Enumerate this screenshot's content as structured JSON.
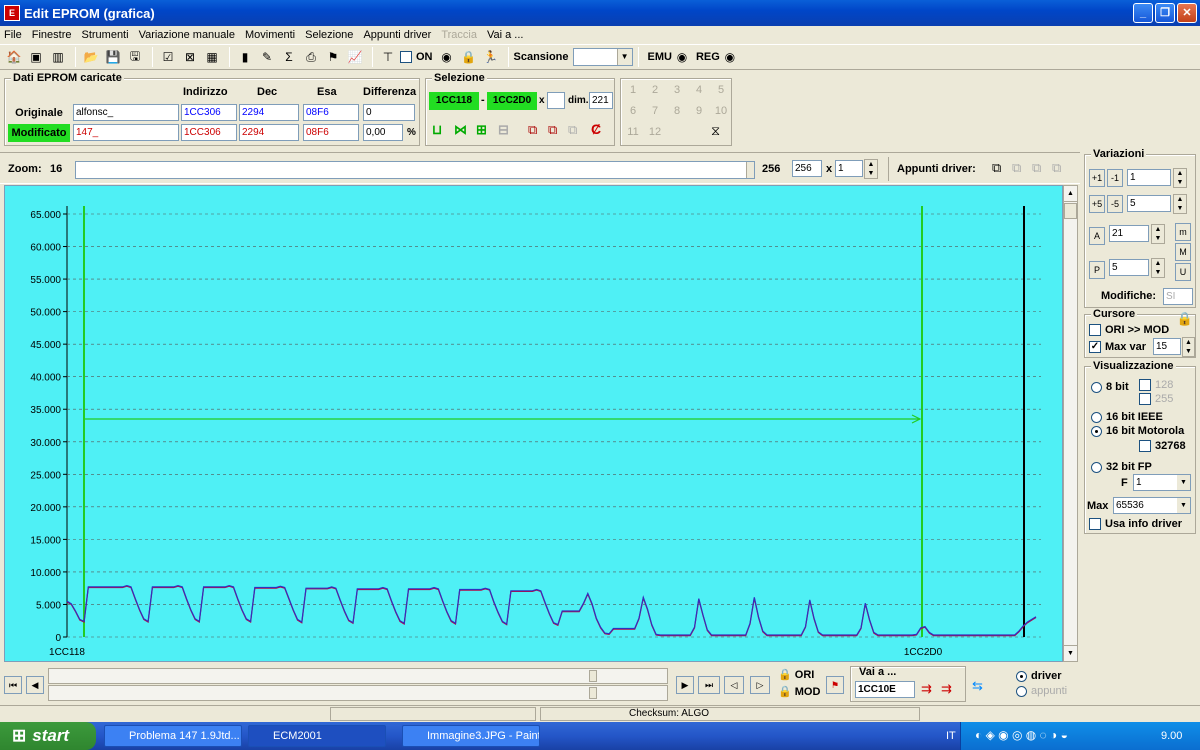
{
  "window": {
    "title": "Edit EPROM (grafica)",
    "minimize": "_",
    "maximize": "❐",
    "close": "✕"
  },
  "menu": [
    "File",
    "Finestre",
    "Strumenti",
    "Variazione manuale",
    "Movimenti",
    "Selezione",
    "Appunti driver",
    "Traccia",
    "Vai a ..."
  ],
  "toolbar": {
    "on_label": "ON",
    "scansione_label": "Scansione",
    "emu_label": "EMU",
    "reg_label": "REG"
  },
  "dati": {
    "title": "Dati EPROM caricate",
    "headers": {
      "indirizzo": "Indirizzo",
      "dec": "Dec",
      "esa": "Esa",
      "differenza": "Differenza"
    },
    "originale": {
      "label": "Originale",
      "name": "alfonsc_",
      "indirizzo": "1CC306",
      "dec": "2294",
      "esa": "08F6",
      "differenza": "0"
    },
    "modificato": {
      "label": "Modificato",
      "name": "147_",
      "indirizzo": "1CC306",
      "dec": "2294",
      "esa": "08F6",
      "differenza": "0,00",
      "unit": "%"
    }
  },
  "selezione": {
    "title": "Selezione",
    "start": "1CC118",
    "dash": "-",
    "end": "1CC2D0",
    "x_label": "x",
    "dim_label": "dim.",
    "dim_value": "221"
  },
  "numpad": [
    "1",
    "2",
    "3",
    "4",
    "5",
    "6",
    "7",
    "8",
    "9",
    "10",
    "11",
    "12"
  ],
  "zoom": {
    "label": "Zoom:",
    "min": "16",
    "max": "256",
    "value": "256",
    "x_label": "x",
    "mult": "1"
  },
  "appunti": {
    "label": "Appunti driver:"
  },
  "chart_data": {
    "type": "line",
    "y_ticks": [
      "65.000",
      "60.000",
      "55.000",
      "50.000",
      "45.000",
      "40.000",
      "35.000",
      "30.000",
      "25.000",
      "20.000",
      "15.000",
      "10.000",
      "5.000",
      "0"
    ],
    "ylim": [
      0,
      65000
    ],
    "x_start_label": "1CC118",
    "x_end_label": "1CC2D0",
    "grid": "dashed horizontal",
    "series": [
      {
        "color": "#d0002a",
        "values": [
          5400,
          5000,
          3900,
          2600,
          2300,
          7600,
          7600,
          7600,
          7600,
          7600,
          7600,
          7600,
          7600,
          7600,
          7800,
          7600,
          5800,
          4100,
          2700,
          2300,
          7600,
          7600,
          7600,
          7600,
          7600,
          7600,
          7800,
          7600,
          5800,
          4100,
          2700,
          2300,
          7600,
          7600,
          7600,
          7600,
          7600,
          7600,
          7800,
          7600,
          5800,
          4100,
          2700,
          2300,
          7500,
          7500,
          7500,
          7500,
          7500,
          7500,
          7700,
          7500,
          5800,
          4100,
          2600,
          2200,
          7400,
          7400,
          7400,
          7400,
          7400,
          7400,
          7600,
          7400,
          5600,
          3900,
          2500,
          2100,
          7300,
          7300,
          7300,
          7300,
          7300,
          7300,
          7500,
          7300,
          5500,
          3800,
          2400,
          2000,
          7300,
          7300,
          7300,
          7300,
          7300,
          7300,
          7500,
          7300,
          5500,
          3800,
          2400,
          2000,
          7200,
          7200,
          7200,
          7200,
          7200,
          7200,
          7400,
          7200,
          5300,
          3700,
          2300,
          1900,
          7000,
          7000,
          7000,
          7000,
          7000,
          7000,
          7200,
          7000,
          5200,
          3500,
          2100,
          1800,
          3900,
          3900,
          3900,
          3900,
          3900,
          5100,
          6600,
          5000,
          2800,
          1400,
          500,
          400,
          1200,
          1200,
          1200,
          1200,
          1200,
          1200,
          2800,
          6000,
          4200,
          1800,
          300,
          200,
          200,
          200,
          200,
          200,
          200,
          200,
          200,
          1400,
          5800,
          3300,
          1000,
          200,
          200,
          200,
          200,
          200,
          200,
          200,
          200,
          200,
          2000,
          6000,
          3000,
          800,
          200,
          200,
          200,
          200,
          200,
          200,
          200,
          200,
          200,
          1500,
          5600,
          2800,
          700,
          200,
          200,
          200,
          200,
          200,
          200,
          200,
          200,
          200,
          1300,
          5100,
          2600,
          600,
          200,
          200,
          200,
          200,
          200,
          200,
          200,
          200,
          200,
          300,
          1300,
          1500,
          600,
          200,
          200,
          200,
          200,
          200,
          200,
          200,
          200,
          200,
          200,
          200,
          200,
          200,
          200,
          200,
          200,
          200,
          200,
          200,
          200,
          800,
          1600,
          2200,
          2600,
          3000
        ]
      },
      {
        "color": "#3030c0",
        "values": [
          5500,
          5100,
          4000,
          2700,
          2400,
          7700,
          7700,
          7700,
          7700,
          7700,
          7700,
          7700,
          7700,
          7700,
          7900,
          7700,
          5900,
          4200,
          2800,
          2400,
          7700,
          7700,
          7700,
          7700,
          7700,
          7700,
          7900,
          7700,
          5900,
          4200,
          2800,
          2400,
          7700,
          7700,
          7700,
          7700,
          7700,
          7700,
          7900,
          7700,
          5900,
          4200,
          2800,
          2400,
          7600,
          7600,
          7600,
          7600,
          7600,
          7600,
          7800,
          7600,
          5900,
          4200,
          2700,
          2300,
          7500,
          7500,
          7500,
          7500,
          7500,
          7500,
          7700,
          7500,
          5700,
          4000,
          2600,
          2200,
          7400,
          7400,
          7400,
          7400,
          7400,
          7400,
          7600,
          7400,
          5600,
          3900,
          2500,
          2100,
          7400,
          7400,
          7400,
          7400,
          7400,
          7400,
          7600,
          7400,
          5600,
          3900,
          2500,
          2100,
          7300,
          7300,
          7300,
          7300,
          7300,
          7300,
          7500,
          7300,
          5400,
          3800,
          2400,
          2000,
          7100,
          7100,
          7100,
          7100,
          7100,
          7100,
          7300,
          7100,
          5300,
          3600,
          2200,
          1900,
          4000,
          4000,
          4000,
          4000,
          4000,
          5200,
          6700,
          5100,
          2900,
          1500,
          600,
          500,
          1300,
          1300,
          1300,
          1300,
          1300,
          1300,
          2900,
          6100,
          4300,
          1900,
          400,
          300,
          300,
          300,
          300,
          300,
          300,
          300,
          300,
          1500,
          5900,
          3400,
          1100,
          300,
          300,
          300,
          300,
          300,
          300,
          300,
          300,
          300,
          2100,
          6100,
          3100,
          900,
          300,
          300,
          300,
          300,
          300,
          300,
          300,
          300,
          300,
          1600,
          5700,
          2900,
          800,
          300,
          300,
          300,
          300,
          300,
          300,
          300,
          300,
          300,
          1400,
          5200,
          2700,
          700,
          300,
          300,
          300,
          300,
          300,
          300,
          300,
          300,
          300,
          400,
          1400,
          1600,
          700,
          300,
          300,
          300,
          300,
          300,
          300,
          300,
          300,
          300,
          300,
          300,
          300,
          300,
          300,
          300,
          300,
          300,
          300,
          300,
          300,
          900,
          1700,
          2300,
          2700,
          3100
        ]
      }
    ],
    "arrow_value": 33500
  },
  "variazioni": {
    "title": "Variazioni",
    "v1": "1",
    "v2": "5",
    "a": "21",
    "p": "5",
    "modifiche_label": "Modifiche:",
    "modifiche_value": "SI"
  },
  "cursore": {
    "title": "Cursore",
    "ori_mod": "ORI >> MOD",
    "maxvar_label": "Max var",
    "maxvar_value": "15"
  },
  "visualizzazione": {
    "title": "Visualizzazione",
    "bit8": "8 bit",
    "c128": "128",
    "c255": "255",
    "ieee": "16 bit IEEE",
    "motorola": "16 bit Motorola",
    "c32768": "32768",
    "fp32": "32 bit FP",
    "f_label": "F",
    "f_value": "1",
    "max_label": "Max",
    "max_value": "65536",
    "usa_info": "Usa info driver"
  },
  "bottom": {
    "ori": "ORI",
    "mod": "MOD",
    "vai_a": "Vai a ...",
    "vai_value": "1CC10E",
    "driver": "driver",
    "appunti": "appunti",
    "checksum": "Checksum: ALGO"
  },
  "taskbar": {
    "start": "start",
    "tasks": [
      "Problema 147 1.9Jtd...",
      "ECM2001",
      "Immagine3.JPG - Paint"
    ],
    "lang": "IT",
    "clock": "9.00"
  }
}
